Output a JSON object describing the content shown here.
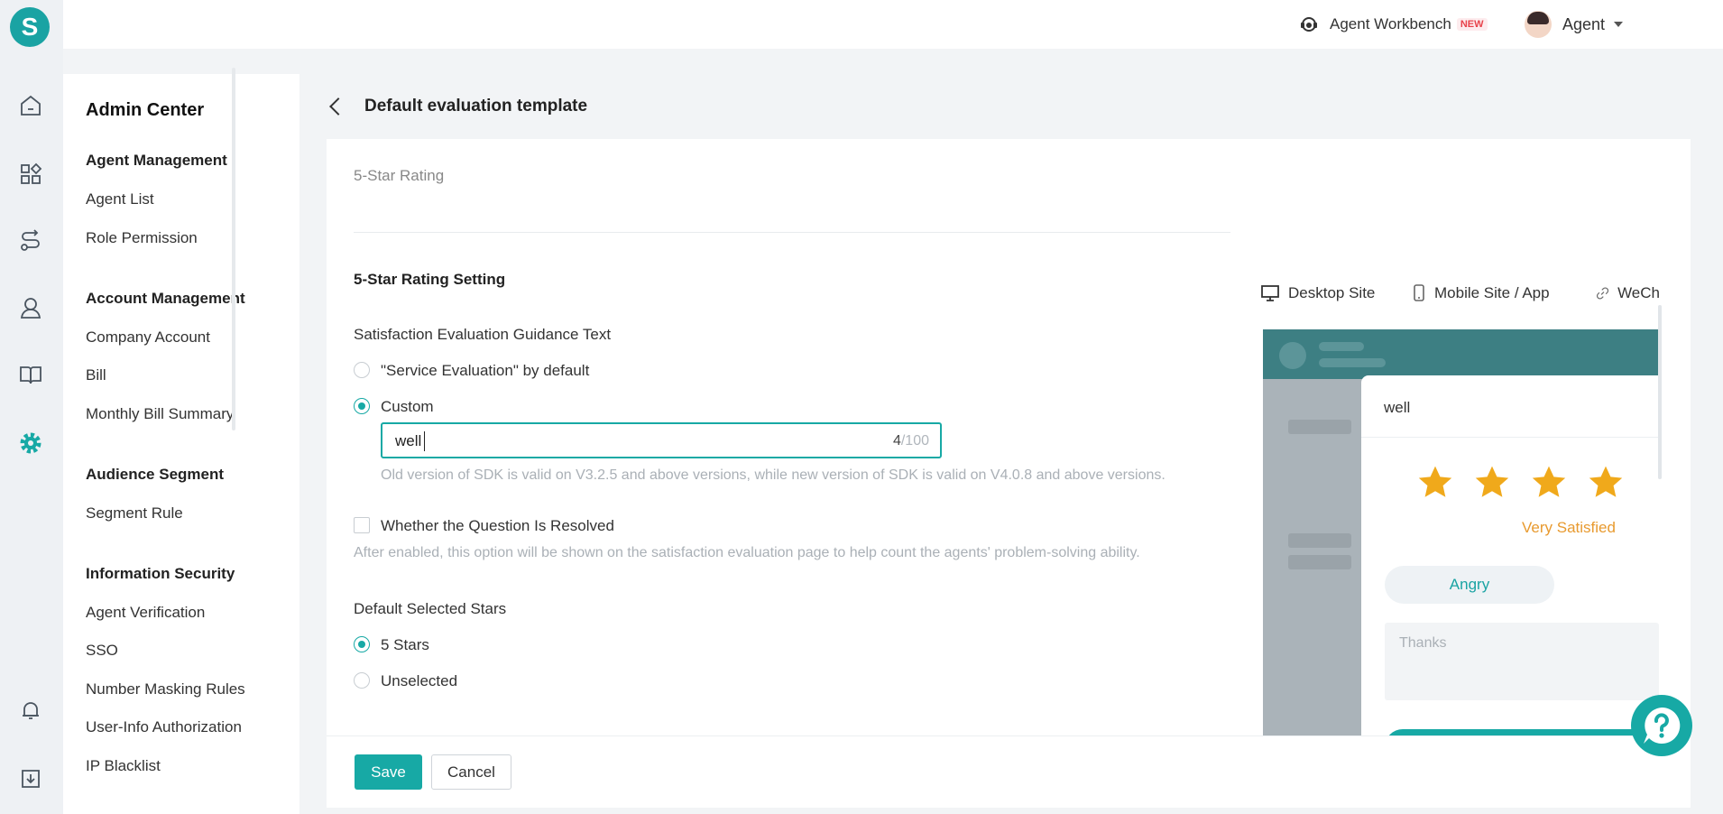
{
  "topbar": {
    "workbench_label": "Agent Workbench",
    "workbench_badge": "NEW",
    "user_name": "Agent"
  },
  "rail": {
    "logo_letter": "S",
    "icons": [
      "home-icon",
      "apps-icon",
      "routing-icon",
      "agent-icon",
      "book-icon",
      "settings-icon",
      "bell-icon",
      "download-icon"
    ]
  },
  "sidebar": {
    "title": "Admin Center",
    "groups": [
      {
        "label": "Agent Management",
        "items": [
          "Agent List",
          "Role Permission"
        ]
      },
      {
        "label": "Account Management",
        "items": [
          "Company Account",
          "Bill",
          "Monthly Bill Summary"
        ]
      },
      {
        "label": "Audience Segment",
        "items": [
          "Segment Rule"
        ]
      },
      {
        "label": "Information Security",
        "items": [
          "Agent Verification",
          "SSO",
          "Number Masking Rules",
          "User-Info Authorization",
          "IP Blacklist"
        ]
      }
    ]
  },
  "page": {
    "title": "Default evaluation template",
    "template_type": "5-Star Rating",
    "section_title": "5-Star Rating Setting",
    "guidance_label": "Satisfaction Evaluation Guidance Text",
    "option_default": "\"Service Evaluation\" by default",
    "option_custom": "Custom",
    "custom_value": "well",
    "char_count": "4",
    "char_max": "/100",
    "sdk_hint": "Old version of SDK is valid on V3.2.5 and above versions, while new version of SDK is valid on V4.0.8 and above versions.",
    "resolved_label": "Whether the Question Is Resolved",
    "resolved_hint": "After enabled, this option will be shown on the satisfaction evaluation page to help count the agents' problem-solving ability.",
    "default_stars_label": "Default Selected Stars",
    "stars_option_5": "5 Stars",
    "stars_option_none": "Unselected",
    "save_label": "Save",
    "cancel_label": "Cancel"
  },
  "preview": {
    "tabs": [
      "Desktop Site",
      "Mobile Site / App",
      "WeCh"
    ],
    "panel_title": "well",
    "rating_text": "Very Satisfied",
    "tag": "Angry",
    "comment_placeholder": "Thanks",
    "star_color": "#f0a91b"
  },
  "colors": {
    "accent": "#17a9a5",
    "star": "#f0a91b"
  }
}
